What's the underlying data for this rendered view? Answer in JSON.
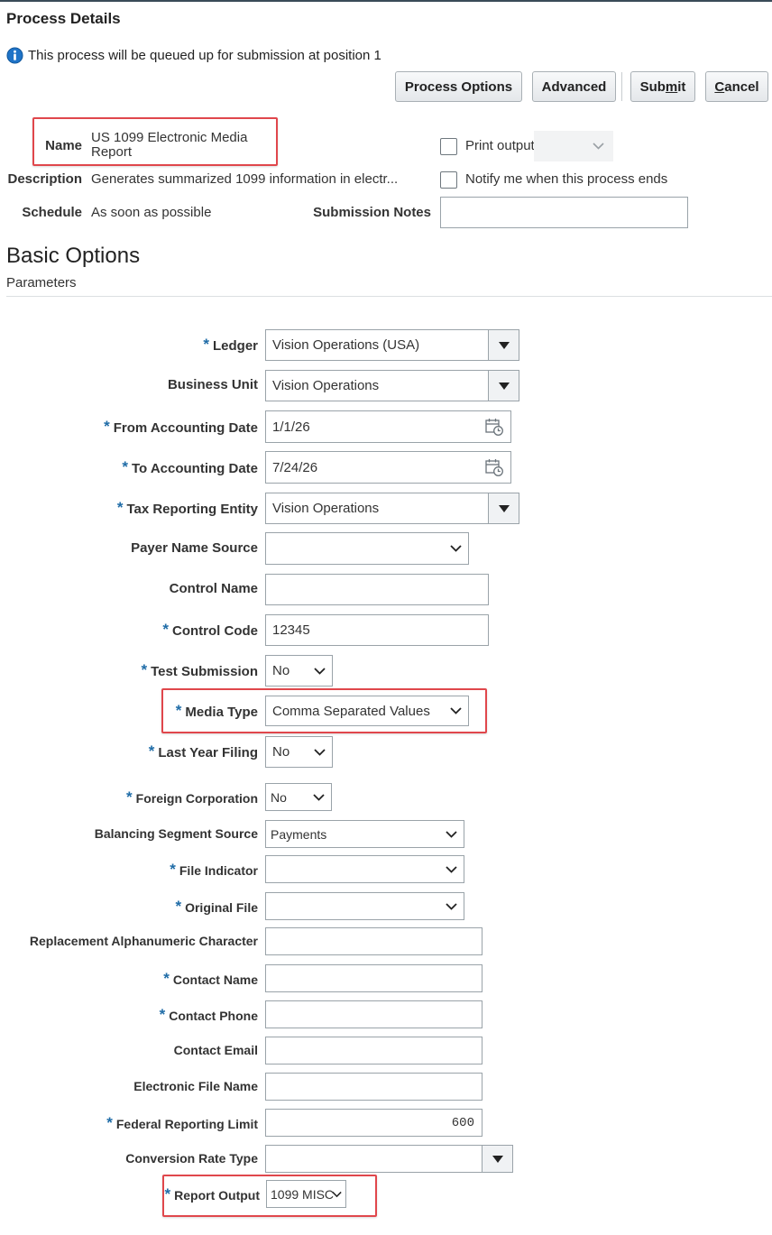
{
  "header": {
    "title": "Process Details",
    "info_text": "This process will be queued up for submission at position 1"
  },
  "toolbar": {
    "process_options_label": "Process Options",
    "advanced_label": "Advanced",
    "submit_pre": "Sub",
    "submit_key": "m",
    "submit_post": "it",
    "cancel_key": "C",
    "cancel_post": "ancel"
  },
  "details": {
    "name_label": "Name",
    "name_line1": "US 1099 Electronic Media",
    "name_line2": "Report",
    "description_label": "Description",
    "description_value": "Generates summarized 1099 information in electr...",
    "schedule_label": "Schedule",
    "schedule_value": "As soon as possible",
    "print_output_label": "Print output",
    "notify_label": "Notify me when this process ends",
    "submission_notes_label": "Submission Notes",
    "submission_notes_value": ""
  },
  "section": {
    "heading": "Basic Options",
    "subheading": "Parameters"
  },
  "params": {
    "ledger": {
      "label": "Ledger",
      "value": "Vision Operations (USA)"
    },
    "business_unit": {
      "label": "Business Unit",
      "value": "Vision Operations"
    },
    "from_date": {
      "label": "From Accounting Date",
      "value": "1/1/26"
    },
    "to_date": {
      "label": "To Accounting Date",
      "value": "7/24/26"
    },
    "tax_entity": {
      "label": "Tax Reporting Entity",
      "value": "Vision Operations"
    },
    "payer_name_source": {
      "label": "Payer Name Source",
      "value": ""
    },
    "control_name": {
      "label": "Control Name",
      "value": ""
    },
    "control_code": {
      "label": "Control Code",
      "value": "12345"
    },
    "test_submission": {
      "label": "Test Submission",
      "value": "No"
    },
    "media_type": {
      "label": "Media Type",
      "value": "Comma Separated Values"
    },
    "last_year_filing": {
      "label": "Last Year Filing",
      "value": "No"
    },
    "foreign_corp": {
      "label": "Foreign Corporation",
      "value": "No"
    },
    "balancing_segment": {
      "label": "Balancing Segment Source",
      "value": "Payments"
    },
    "file_indicator": {
      "label": "File Indicator",
      "value": ""
    },
    "original_file": {
      "label": "Original File",
      "value": ""
    },
    "replacement_char": {
      "label": "Replacement Alphanumeric Character",
      "value": ""
    },
    "contact_name": {
      "label": "Contact Name",
      "value": ""
    },
    "contact_phone": {
      "label": "Contact Phone",
      "value": ""
    },
    "contact_email": {
      "label": "Contact Email",
      "value": ""
    },
    "electronic_file_name": {
      "label": "Electronic File Name",
      "value": ""
    },
    "federal_limit": {
      "label": "Federal Reporting Limit",
      "value": "600"
    },
    "conversion_rate": {
      "label": "Conversion Rate Type",
      "value": ""
    },
    "report_output": {
      "label": "Report Output",
      "value": "1099 MISC"
    }
  },
  "colors": {
    "required": "#1f6ca7",
    "highlight": "#e0474c",
    "info": "#1f73c7"
  }
}
